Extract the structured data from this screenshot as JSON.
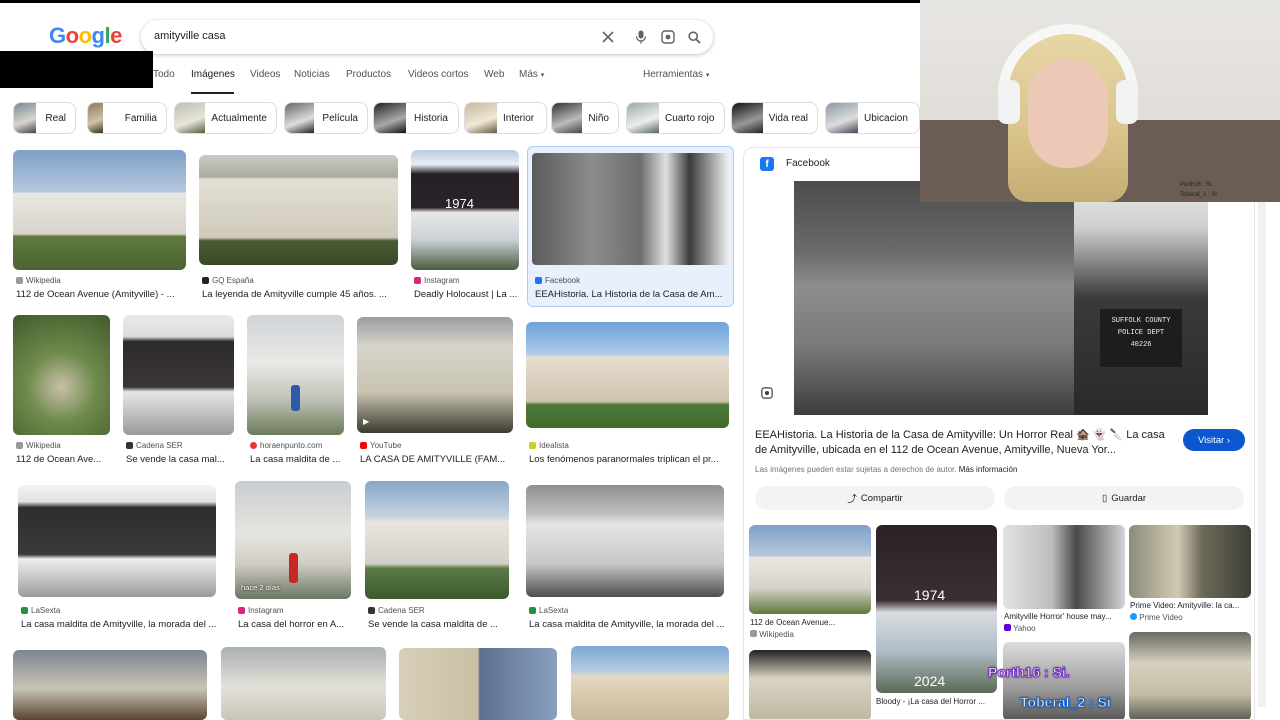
{
  "search": {
    "logo": "Google",
    "query": "amityville casa",
    "logo_colors": [
      "#4285F4",
      "#EA4335",
      "#FBBC05",
      "#4285F4",
      "#34A853",
      "#EA4335"
    ]
  },
  "tabs": {
    "items": [
      "Todo",
      "Imágenes",
      "Videos",
      "Noticias",
      "Productos",
      "Videos cortos",
      "Web",
      "Más"
    ],
    "active": "Imágenes",
    "tools": "Herramientas"
  },
  "chips": [
    "Real",
    "Familia",
    "Actualmente",
    "Película",
    "Historia",
    "Interior",
    "Niño",
    "Cuarto rojo",
    "Vida real",
    "Ubicacion"
  ],
  "results": [
    {
      "source": "Wikipedia",
      "title": "112 de Ocean Avenue (Amityville) - ..."
    },
    {
      "source": "GQ España",
      "title": "La leyenda de Amityville cumple 45 años. ..."
    },
    {
      "source": "Instagram",
      "title": "Deadly Holocaust | La ...",
      "overlay_year": "1974"
    },
    {
      "source": "Facebook",
      "title": "EEAHistoria. La Historia de la Casa de Am..."
    },
    {
      "source": "Wikipedia",
      "title": "112 de Ocean Ave..."
    },
    {
      "source": "Cadena SER",
      "title": "Se vende la casa mal..."
    },
    {
      "source": "horaenpunto.com",
      "title": "La casa maldita de ..."
    },
    {
      "source": "YouTube",
      "title": "LA CASA DE AMITYVILLE (FAM..."
    },
    {
      "source": "Idealista",
      "title": "Los fenómenos paranormales triplican el pr..."
    },
    {
      "source": "LaSexta",
      "title": "La casa maldita de Amityville, la morada del ..."
    },
    {
      "source": "Instagram",
      "title": "La casa del horror en A...",
      "badge": "hace 2 días"
    },
    {
      "source": "Cadena SER",
      "title": "Se vende la casa maldita de ..."
    },
    {
      "source": "LaSexta",
      "title": "La casa maldita de Amityville, la morada del ..."
    }
  ],
  "panel": {
    "source": "Facebook",
    "title": "EEAHistoria. La Historia de la Casa de Amityville: Un Horror Real 🏚️ 👻 🔪 La casa de Amityville, ubicada en el 112 de Ocean Avenue, Amityville, Nueva Yor...",
    "visit": "Visitar",
    "rights": "Las imágenes pueden estar sujetas a derechos de autor.",
    "more_info": "Más información",
    "share": "Compartir",
    "save": "Guardar",
    "mugshot_text": "SUFFOLK COUNTY POLICE DEPT 40226",
    "related": [
      {
        "caption": "112 de Ocean Avenue...",
        "source": "Wikipedia"
      },
      {
        "caption": "Bloody - ¡La casa del Horror ...",
        "year_top": "1974",
        "year_bottom": "2024"
      },
      {
        "caption": "Amityville Horror' house may...",
        "source": "Yahoo"
      },
      {
        "caption": "Prime Video: Amityville: la ca...",
        "source": "Prime Video"
      }
    ]
  },
  "stream": {
    "chat_1": "Porth16 : Si.",
    "chat_2": "Toberal_2 : Si",
    "overlay_1": "Porth16 : Si.",
    "overlay_2": "Toberal_2 : Si"
  }
}
